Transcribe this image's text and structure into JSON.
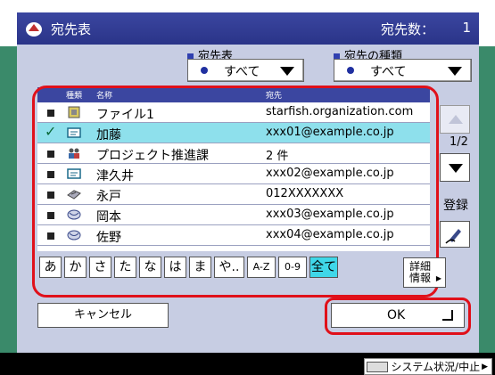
{
  "titlebar": {
    "title": "宛先表",
    "count_label": "宛先数：",
    "count_value": "1"
  },
  "filters": {
    "addressbook": {
      "label": "宛先表",
      "value": "すべて"
    },
    "type": {
      "label": "宛先の種類",
      "value": "すべて"
    }
  },
  "columns": {
    "type": "種類",
    "name": "名称",
    "address": "宛先"
  },
  "rows": [
    {
      "icon": "file-icon",
      "name": "ファイル1",
      "address": "starfish.organization.com",
      "checked": false
    },
    {
      "icon": "card-icon",
      "name": "加藤",
      "address": "xxx01@example.co.jp",
      "checked": true
    },
    {
      "icon": "group-icon",
      "name": "プロジェクト推進課",
      "address": "2 件",
      "checked": false
    },
    {
      "icon": "card-icon",
      "name": "津久井",
      "address": "xxx02@example.co.jp",
      "checked": false
    },
    {
      "icon": "fax-icon",
      "name": "永戸",
      "address": "012XXXXXXX",
      "checked": false
    },
    {
      "icon": "email-icon",
      "name": "岡本",
      "address": "xxx03@example.co.jp",
      "checked": false
    },
    {
      "icon": "email-icon",
      "name": "佐野",
      "address": "xxx04@example.co.jp",
      "checked": false
    }
  ],
  "pager": {
    "page": "1/2"
  },
  "register_label": "登録",
  "kana": [
    "あ",
    "か",
    "さ",
    "た",
    "な",
    "は",
    "ま",
    "や..",
    "A-Z",
    "0-9",
    "全て"
  ],
  "detail_label_1": "詳細",
  "detail_label_2": "情報",
  "cancel_label": "キャンセル",
  "ok_label": "OK",
  "status_label": "システム状況/中止",
  "colors": {
    "titlebar": "#3b46a0",
    "selected_row": "#8ee0ec",
    "highlight": "#e0101a",
    "panel": "#c7cde3"
  }
}
